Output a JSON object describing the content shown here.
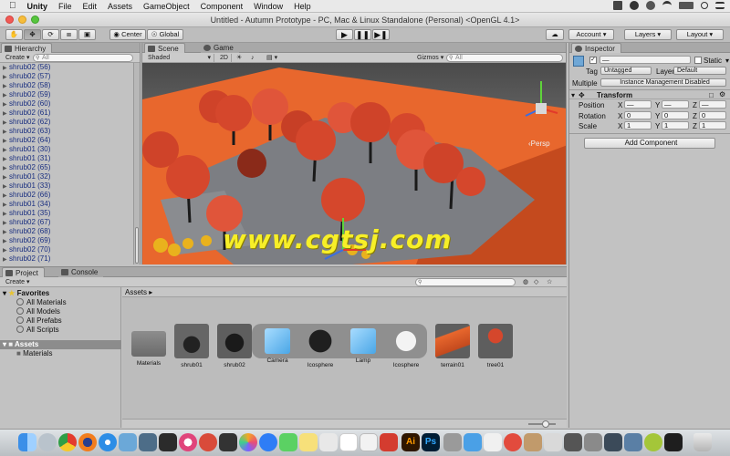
{
  "menubar": {
    "app": "Unity",
    "items": [
      "File",
      "Edit",
      "Assets",
      "GameObject",
      "Component",
      "Window",
      "Help"
    ]
  },
  "window": {
    "title": "Untitled - Autumn Prototype - PC, Mac & Linux Standalone (Personal) <OpenGL 4.1>"
  },
  "toolbar": {
    "pivot_label": "Center",
    "space_label": "Global",
    "account_label": "Account",
    "layers_label": "Layers",
    "layout_label": "Layout"
  },
  "hierarchy": {
    "tab_label": "Hierarchy",
    "create_label": "Create",
    "search_placeholder": "All",
    "items": [
      "shrub02 (56)",
      "shrub02 (57)",
      "shrub02 (58)",
      "shrub02 (59)",
      "shrub02 (60)",
      "shrub02 (61)",
      "shrub02 (62)",
      "shrub02 (63)",
      "shrub02 (64)",
      "shrub01 (30)",
      "shrub01 (31)",
      "shrub02 (65)",
      "shrub01 (32)",
      "shrub01 (33)",
      "shrub02 (66)",
      "shrub01 (34)",
      "shrub01 (35)",
      "shrub02 (67)",
      "shrub02 (68)",
      "shrub02 (69)",
      "shrub02 (70)",
      "shrub02 (71)"
    ]
  },
  "scene": {
    "tab_scene": "Scene",
    "tab_game": "Game",
    "shading": "Shaded",
    "mode_2d": "2D",
    "gizmos": "Gizmos",
    "search_placeholder": "All",
    "persp_label": "Persp",
    "watermark": "www.cgtsj.com",
    "palette": {
      "tree_red": "#d5472c",
      "tree_dark": "#8a2a19",
      "ground_orange": "#e8672d",
      "shadow": "#7c7e83",
      "shrub_yellow": "#e9b21d"
    }
  },
  "inspector": {
    "tab_label": "Inspector",
    "static_label": "Static",
    "tag_label": "Tag",
    "tag_value": "Untagged",
    "layer_label": "Layer",
    "layer_value": "Default",
    "multiple_label": "Multiple",
    "instance_label": "Instance Management Disabled",
    "transform_label": "Transform",
    "position_label": "Position",
    "rotation_label": "Rotation",
    "scale_label": "Scale",
    "axis_x": "X",
    "axis_y": "Y",
    "axis_z": "Z",
    "position": {
      "x": "—",
      "y": "—",
      "z": "—"
    },
    "rotation": {
      "x": "0",
      "y": "0",
      "z": "0"
    },
    "scale": {
      "x": "1",
      "y": "1",
      "z": "1"
    },
    "add_component": "Add Component"
  },
  "project": {
    "tab_project": "Project",
    "tab_console": "Console",
    "create_label": "Create",
    "favorites_label": "Favorites",
    "favorites": [
      "All Materials",
      "All Models",
      "All Prefabs",
      "All Scripts"
    ],
    "assets_label": "Assets",
    "assets_children": [
      "Materials"
    ],
    "breadcrumb": "Assets",
    "assets": [
      "Materials",
      "shrub01",
      "shrub02",
      "Camera",
      "Icosphere",
      "Lamp",
      "Icosphere",
      "terrain01",
      "tree01"
    ]
  }
}
